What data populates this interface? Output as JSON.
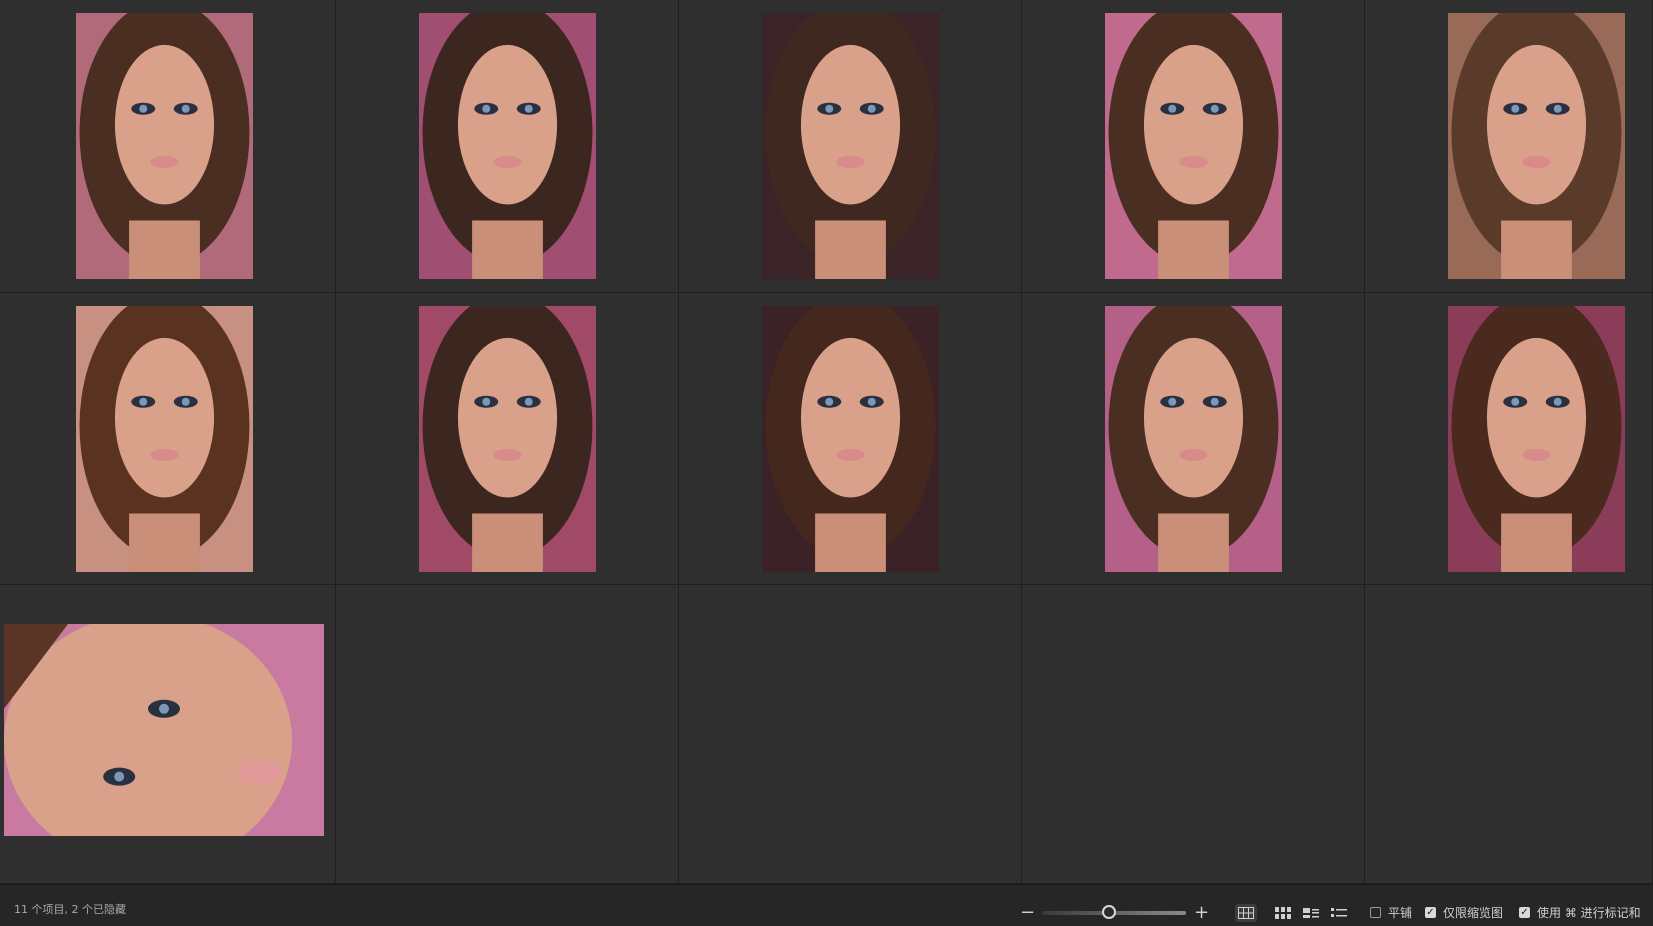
{
  "status": {
    "text": "11 个项目, 2 个已隐藏"
  },
  "zoom": {
    "minus_label": "−",
    "plus_label": "+",
    "level": 0.45
  },
  "view_modes": [
    {
      "name": "grid-view-icon",
      "active": true
    },
    {
      "name": "tile-view-icon",
      "active": false
    },
    {
      "name": "filmstrip-view-icon",
      "active": false
    },
    {
      "name": "list-view-icon",
      "active": false
    }
  ],
  "options": {
    "tile": {
      "label": "平铺",
      "checked": false
    },
    "thumbs_only": {
      "label": "仅限缩览图",
      "checked": true
    },
    "use_marking": {
      "label": "使用 ⌘ 进行标记和",
      "checked": true
    }
  },
  "thumbnails": [
    {
      "index": 1,
      "bg": "#b06a7a",
      "hair": "#4a2e22"
    },
    {
      "index": 2,
      "bg": "#a04f72",
      "hair": "#3c2620"
    },
    {
      "index": 3,
      "bg": "#3b2428",
      "hair": "#3e2820"
    },
    {
      "index": 4,
      "bg": "#c06a8e",
      "hair": "#4a2e22"
    },
    {
      "index": 5,
      "bg": "#9a6a58",
      "hair": "#5a3a28"
    },
    {
      "index": 6,
      "bg": "#c89080",
      "hair": "#5a3220"
    },
    {
      "index": 7,
      "bg": "#a04a68",
      "hair": "#3c2620"
    },
    {
      "index": 8,
      "bg": "#3a2226",
      "hair": "#44281e"
    },
    {
      "index": 9,
      "bg": "#b46088",
      "hair": "#4a2e22"
    },
    {
      "index": 10,
      "bg": "#8a3c58",
      "hair": "#4a2a1e"
    },
    {
      "index": 11,
      "bg": "#c87aa0",
      "hair": "#5a3424"
    }
  ]
}
